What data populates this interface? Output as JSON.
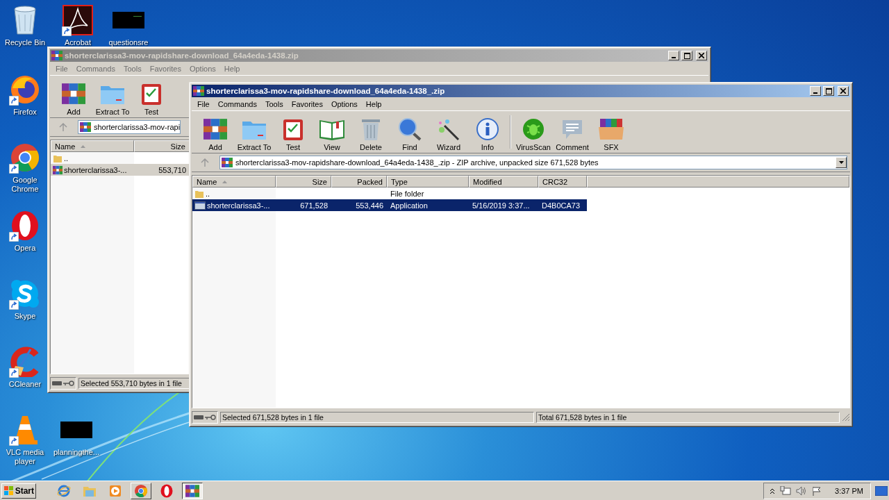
{
  "desktop_icons": [
    {
      "label": "Recycle Bin",
      "shortcut": false
    },
    {
      "label": "Acrobat",
      "shortcut": true
    },
    {
      "label": "questionsre",
      "shortcut": false
    },
    {
      "label": "Firefox",
      "shortcut": true
    },
    {
      "label": "Google Chrome",
      "shortcut": true
    },
    {
      "label": "Opera",
      "shortcut": true
    },
    {
      "label": "Skype",
      "shortcut": true
    },
    {
      "label": "CCleaner",
      "shortcut": true
    },
    {
      "label": "VLC media player",
      "shortcut": true
    },
    {
      "label": "planningthe...",
      "shortcut": false
    }
  ],
  "windows": [
    {
      "active": false,
      "title": "shorterclarissa3-mov-rapidshare-download_64a4eda-1438.zip",
      "menu": [
        "File",
        "Commands",
        "Tools",
        "Favorites",
        "Options",
        "Help"
      ],
      "toolbar_groups": [
        [
          "Add",
          "Extract To",
          "Test"
        ]
      ],
      "address": "shorterclarissa3-mov-rapi",
      "columns": [
        "Name",
        "Size"
      ],
      "rows": [
        {
          "kind": "folder",
          "selected": false,
          "name": ".."
        },
        {
          "kind": "archive",
          "selected": true,
          "name": "shorterclarissa3-...",
          "size": "553,710"
        }
      ],
      "status": [
        "Selected 553,710 bytes in 1 file"
      ]
    },
    {
      "active": true,
      "title": "shorterclarissa3-mov-rapidshare-download_64a4eda-1438_.zip",
      "menu": [
        "File",
        "Commands",
        "Tools",
        "Favorites",
        "Options",
        "Help"
      ],
      "toolbar_groups": [
        [
          "Add",
          "Extract To",
          "Test",
          "View",
          "Delete",
          "Find",
          "Wizard",
          "Info"
        ],
        [
          "VirusScan",
          "Comment",
          "SFX"
        ]
      ],
      "address": "shorterclarissa3-mov-rapidshare-download_64a4eda-1438_.zip - ZIP archive, unpacked size 671,528 bytes",
      "columns": [
        "Name",
        "Size",
        "Packed",
        "Type",
        "Modified",
        "CRC32"
      ],
      "rows": [
        {
          "kind": "folder",
          "selected": false,
          "name": "..",
          "type": "File folder"
        },
        {
          "kind": "application",
          "selected": true,
          "name": "shorterclarissa3-...",
          "size": "671,528",
          "packed": "553,446",
          "type": "Application",
          "modified": "5/16/2019 3:37...",
          "crc32": "D4B0CA73"
        }
      ],
      "status": [
        "Selected 671,528 bytes in 1 file",
        "Total 671,528 bytes in 1 file"
      ]
    }
  ],
  "taskbar": {
    "start": "Start",
    "items": [
      {
        "open": false,
        "selected": false
      },
      {
        "open": false,
        "selected": false
      },
      {
        "open": false,
        "selected": false
      },
      {
        "open": true,
        "selected": false
      },
      {
        "open": false,
        "selected": false
      },
      {
        "open": true,
        "selected": true
      }
    ],
    "clock": "3:37 PM"
  }
}
